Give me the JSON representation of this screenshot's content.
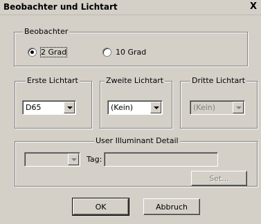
{
  "window": {
    "title": "Beobachter und Lichtart",
    "close_label": "X"
  },
  "observer": {
    "legend": "Beobachter",
    "option1": "2 Grad",
    "option2": "10 Grad",
    "selected": "2 Grad"
  },
  "first_illuminant": {
    "legend": "Erste Lichtart",
    "value": "D65"
  },
  "second_illuminant": {
    "legend": "Zweite Lichtart",
    "value": "(Kein)"
  },
  "third_illuminant": {
    "legend": "Dritte Lichtart",
    "value": "(Kein)"
  },
  "user_illuminant": {
    "legend": "User Illuminant Detail",
    "combo_value": "",
    "tag_label": "Tag:",
    "tag_value": "",
    "set_label": "Set..."
  },
  "buttons": {
    "ok": "OK",
    "cancel": "Abbruch"
  }
}
